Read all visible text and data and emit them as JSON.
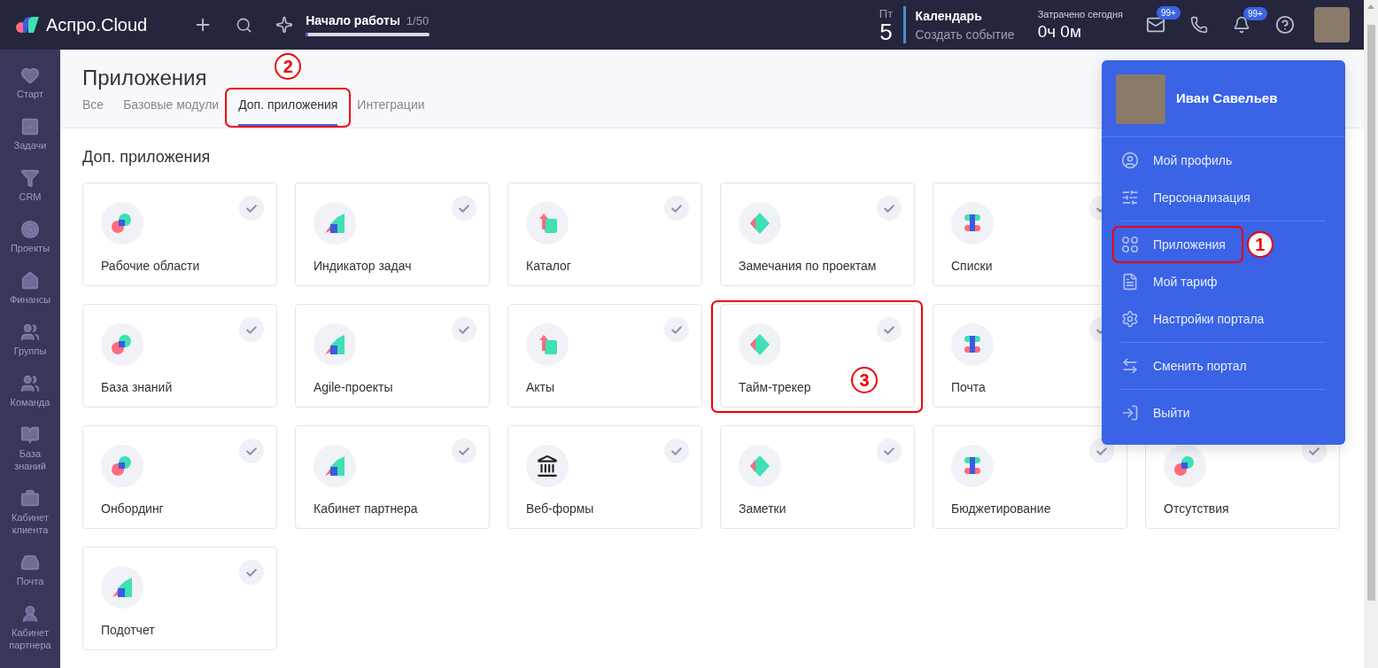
{
  "topbar": {
    "logo": "Аспро.Cloud",
    "onboarding": {
      "label": "Начало работы",
      "count": "1/50",
      "level": 0.02
    },
    "calendar": {
      "weekday": "Пт",
      "day": "5",
      "title": "Календарь",
      "action": "Создать событие"
    },
    "time": {
      "label": "Затрачено сегодня",
      "value": "0ч 0м"
    },
    "mail_badge": "99+",
    "bell_badge": "99+"
  },
  "sidebar": {
    "items": [
      {
        "label": "Старт"
      },
      {
        "label": "Задачи"
      },
      {
        "label": "CRM"
      },
      {
        "label": "Проекты"
      },
      {
        "label": "Финансы"
      },
      {
        "label": "Группы"
      },
      {
        "label": "Команда"
      },
      {
        "label": "База знаний"
      },
      {
        "label": "Кабинет клиента"
      },
      {
        "label": "Почта"
      },
      {
        "label": "Кабинет партнера"
      }
    ]
  },
  "page": {
    "title": "Приложения",
    "tabs": [
      {
        "label": "Все",
        "selected": false,
        "highlighted": false
      },
      {
        "label": "Базовые модули",
        "selected": false,
        "highlighted": false
      },
      {
        "label": "Доп. приложения",
        "selected": true,
        "highlighted": true,
        "step": "2"
      },
      {
        "label": "Интеграции",
        "selected": false,
        "highlighted": false
      }
    ]
  },
  "section_title": "Доп. приложения",
  "card_rows": [
    [
      {
        "name": "Рабочие области",
        "installed": true,
        "highlighted": false
      },
      {
        "name": "Индикатор задач",
        "installed": true,
        "highlighted": false
      },
      {
        "name": "Каталог",
        "installed": true,
        "highlighted": false
      },
      {
        "name": "Замечания по проектам",
        "installed": true,
        "highlighted": false
      },
      {
        "name": "Списки",
        "installed": true,
        "highlighted": false
      }
    ],
    [
      {
        "name": "База знаний",
        "installed": true,
        "highlighted": false
      },
      {
        "name": "Agile-проекты",
        "installed": true,
        "highlighted": false
      },
      {
        "name": "Акты",
        "installed": true,
        "highlighted": false
      },
      {
        "name": "Тайм-трекер",
        "installed": true,
        "highlighted": true,
        "step": "3"
      },
      {
        "name": "Почта",
        "installed": true,
        "highlighted": false
      }
    ],
    [
      {
        "name": "Онбординг",
        "installed": true,
        "highlighted": false
      },
      {
        "name": "Кабинет партнера",
        "installed": true,
        "highlighted": false
      },
      {
        "name": "Веб-формы",
        "installed": true,
        "highlighted": false
      },
      {
        "name": "Заметки",
        "installed": true,
        "highlighted": false
      },
      {
        "name": "Бюджетирование",
        "installed": true,
        "highlighted": false
      },
      {
        "name": "Отсутствия",
        "installed": true,
        "highlighted": false
      }
    ],
    [
      {
        "name": "Подотчет",
        "installed": true,
        "highlighted": false
      }
    ]
  ],
  "user_menu": {
    "name": "Иван Савельев",
    "groups": [
      [
        {
          "label": "Мой профиль",
          "highlighted": false
        },
        {
          "label": "Персонализация",
          "highlighted": false
        }
      ],
      [
        {
          "label": "Приложения",
          "highlighted": true,
          "step": "1"
        },
        {
          "label": "Мой тариф",
          "highlighted": false
        },
        {
          "label": "Настройки портала",
          "highlighted": false
        }
      ],
      [
        {
          "label": "Сменить портал",
          "highlighted": false
        }
      ],
      [
        {
          "label": "Выйти",
          "highlighted": false
        }
      ]
    ]
  }
}
